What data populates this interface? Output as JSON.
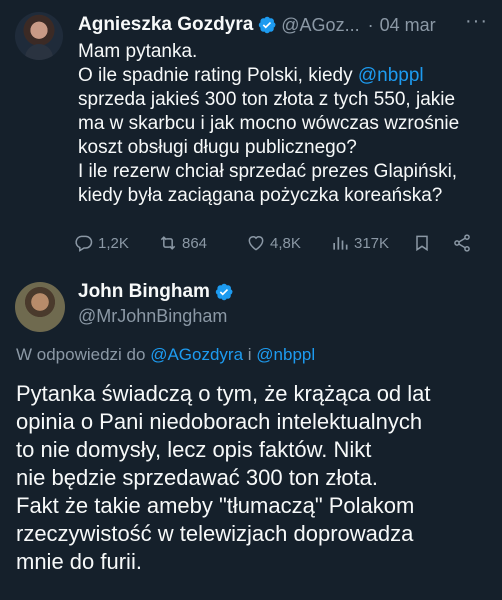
{
  "tweet": {
    "author_name": "Agnieszka Gozdyra",
    "author_handle": "@AGoz...",
    "separator": "·",
    "date": "04 mar",
    "more": "···",
    "lines": [
      {
        "pre": "Mam pytanka.",
        "mention": "",
        "post": ""
      },
      {
        "pre": "O ile spadnie rating Polski, kiedy ",
        "mention": "@nbppl",
        "post": ""
      },
      {
        "pre": "sprzeda jakieś 300 ton złota z tych 550, jakie",
        "mention": "",
        "post": ""
      },
      {
        "pre": "ma w skarbcu i jak mocno wówczas wzrośnie",
        "mention": "",
        "post": ""
      },
      {
        "pre": "koszt obsługi długu publicznego?",
        "mention": "",
        "post": ""
      },
      {
        "pre": "I ile rezerw chciał sprzedać prezes Glapiński,",
        "mention": "",
        "post": ""
      },
      {
        "pre": "kiedy była zaciągana pożyczka koreańska?",
        "mention": "",
        "post": ""
      }
    ],
    "stats": {
      "replies": "1,2K",
      "retweets": "864",
      "likes": "4,8K",
      "views": "317K"
    }
  },
  "reply": {
    "author_name": "John Bingham",
    "author_handle": "@MrJohnBingham",
    "replying_prefix": "W odpowiedzi do ",
    "replying_to_1": "@AGozdyra",
    "replying_conj": " i ",
    "replying_to_2": "@nbppl",
    "lines": [
      "Pytanka świadczą o tym, że krążąca od lat",
      "opinia o Pani niedoborach intelektualnych",
      "to nie domysły, lecz opis faktów. Nikt",
      "nie będzie sprzedawać 300 ton złota.",
      "Fakt że takie ameby \"tłumaczą\" Polakom",
      "rzeczywistość w telewizjach doprowadza",
      "mnie do furii."
    ]
  },
  "colors": {
    "background": "#15202b",
    "text": "#f7f9f9",
    "muted": "#8b98a5",
    "accent": "#1d9bf0"
  },
  "icons": [
    "verified-badge-icon",
    "reply-icon",
    "retweet-icon",
    "like-icon",
    "views-icon",
    "bookmark-icon",
    "share-icon",
    "more-icon"
  ]
}
